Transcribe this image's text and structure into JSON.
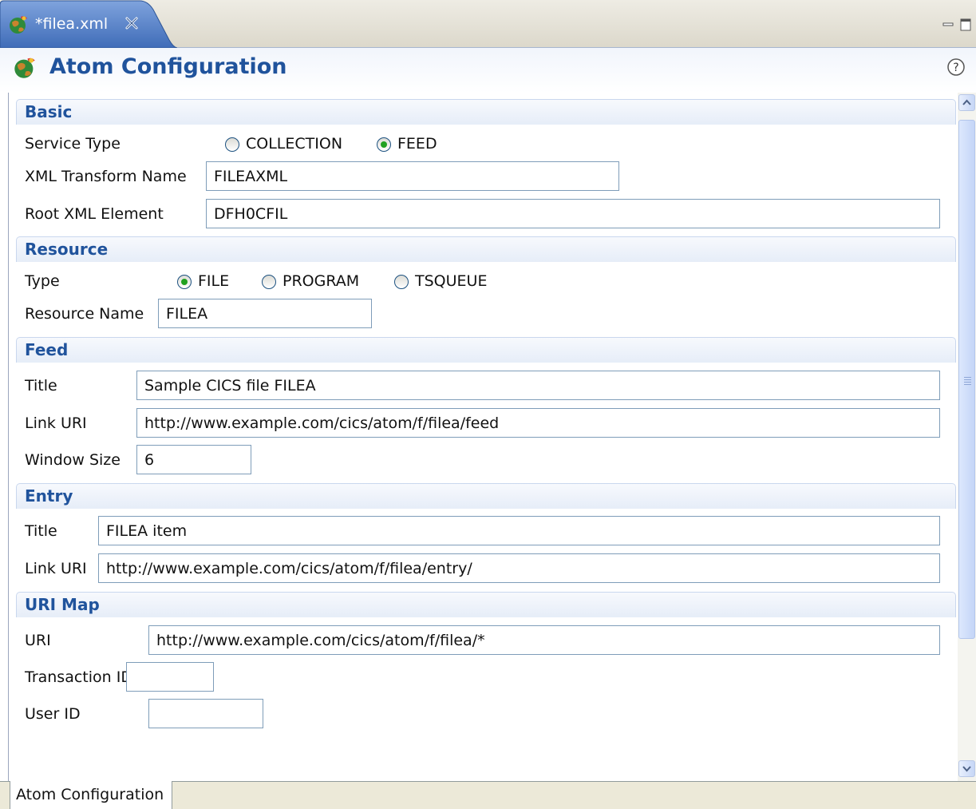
{
  "editor_tab": {
    "title": "*filea.xml"
  },
  "header": {
    "title": "Atom Configuration"
  },
  "sections": {
    "basic": {
      "title": "Basic",
      "service_type_label": "Service Type",
      "service_type_options": [
        "COLLECTION",
        "FEED"
      ],
      "service_type_selected": "FEED",
      "xml_transform_label": "XML Transform Name",
      "xml_transform_value": "FILEAXML",
      "root_element_label": "Root XML Element",
      "root_element_value": "DFH0CFIL"
    },
    "resource": {
      "title": "Resource",
      "type_label": "Type",
      "type_options": [
        "FILE",
        "PROGRAM",
        "TSQUEUE"
      ],
      "type_selected": "FILE",
      "name_label": "Resource Name",
      "name_value": "FILEA"
    },
    "feed": {
      "title": "Feed",
      "title_label": "Title",
      "title_value": "Sample CICS file FILEA",
      "link_label": "Link URI",
      "link_value": "http://www.example.com/cics/atom/f/filea/feed",
      "window_label": "Window Size",
      "window_value": "6"
    },
    "entry": {
      "title": "Entry",
      "title_label": "Title",
      "title_value": "FILEA item",
      "link_label": "Link URI",
      "link_value": "http://www.example.com/cics/atom/f/filea/entry/"
    },
    "urimap": {
      "title": "URI Map",
      "uri_label": "URI",
      "uri_value": "http://www.example.com/cics/atom/f/filea/*",
      "tran_label": "Transaction ID",
      "tran_value": "",
      "user_label": "User ID",
      "user_value": ""
    }
  },
  "page_tabs": [
    "Atom Configuration"
  ],
  "icons": {
    "editor": "atom-globe-icon",
    "close": "close-icon",
    "help": "help-icon",
    "minimize": "minimize-icon",
    "maximize": "maximize-icon"
  },
  "colors": {
    "section_title": "#20539c",
    "tab_active": "#4f7cc4",
    "radio_dot": "#21a121"
  }
}
